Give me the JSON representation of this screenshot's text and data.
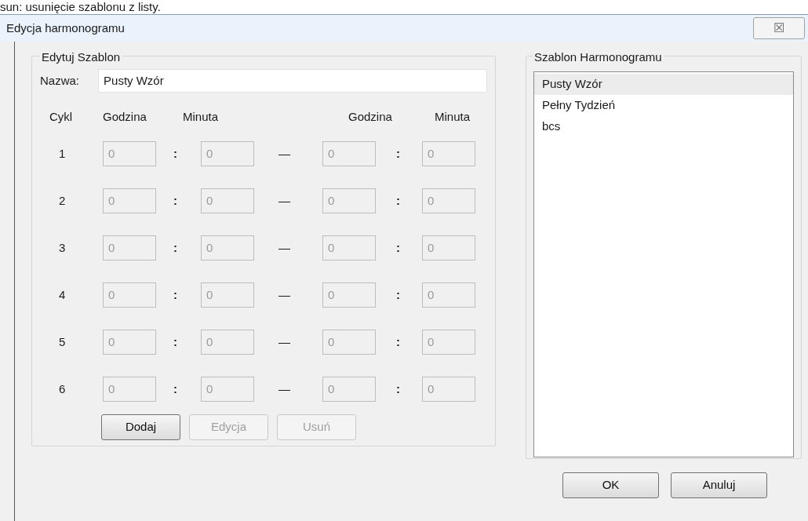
{
  "top_text": "sun: usunięcie szablonu z listy.",
  "window": {
    "title": "Edycja harmonogramu",
    "close": "☒"
  },
  "edit_group": {
    "title": "Edytuj Szablon",
    "name_label": "Nazwa:",
    "name_value": "Pusty Wzór",
    "columns": [
      "Cykl",
      "Godzina",
      "Minuta",
      "Godzina",
      "Minuta"
    ],
    "separator": ":",
    "dash": "—",
    "rows": [
      {
        "cycle": "1",
        "disabled": true,
        "values": [
          "0",
          "0",
          "0",
          "0"
        ]
      },
      {
        "cycle": "2",
        "disabled": true,
        "values": [
          "0",
          "0",
          "0",
          "0"
        ]
      },
      {
        "cycle": "3",
        "disabled": true,
        "values": [
          "0",
          "0",
          "0",
          "0"
        ]
      },
      {
        "cycle": "4",
        "disabled": true,
        "values": [
          "0",
          "0",
          "0",
          "0"
        ]
      },
      {
        "cycle": "5",
        "disabled": true,
        "values": [
          "0",
          "0",
          "0",
          "0"
        ]
      },
      {
        "cycle": "6",
        "disabled": true,
        "values": [
          "0",
          "0",
          "0",
          "0"
        ]
      }
    ],
    "buttons": [
      {
        "label": "Dodaj",
        "disabled": false
      },
      {
        "label": "Edycja",
        "disabled": true
      },
      {
        "label": "Usuń",
        "disabled": true
      }
    ]
  },
  "template_group": {
    "title": "Szablon Harmonogramu",
    "items": [
      {
        "label": "Pusty Wzór",
        "selected": true
      },
      {
        "label": "Pełny Tydzień",
        "selected": false
      },
      {
        "label": "bcs",
        "selected": false
      }
    ]
  },
  "buttons": [
    "OK",
    "Anuluj"
  ]
}
